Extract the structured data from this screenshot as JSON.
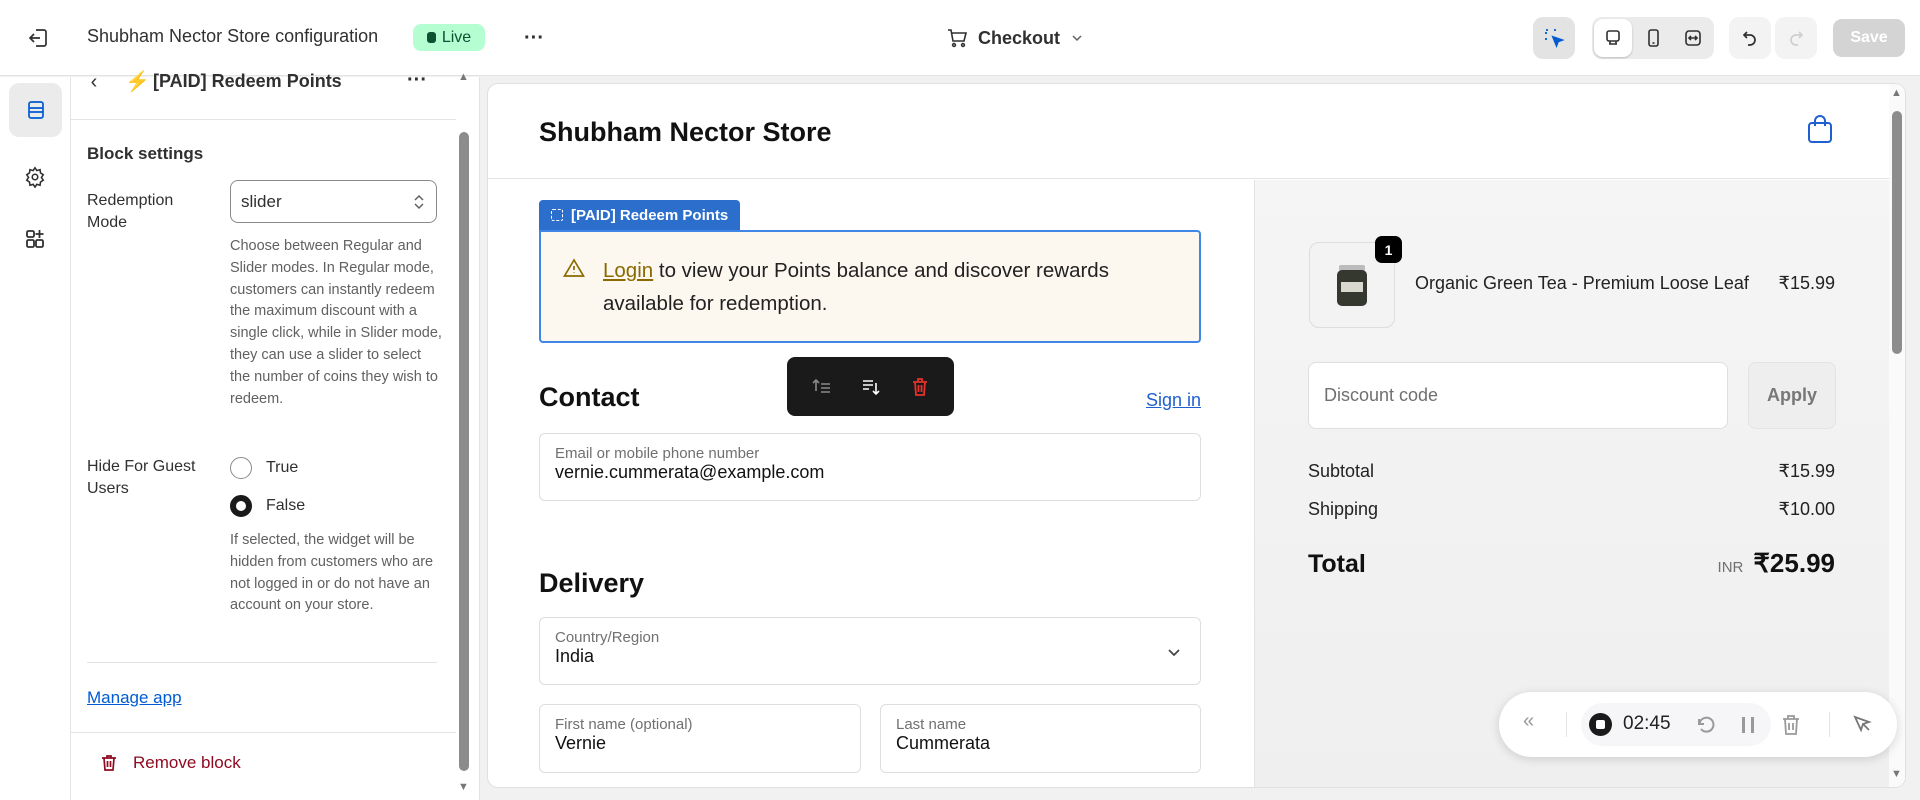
{
  "topbar": {
    "title": "Shubham Nector Store configuration",
    "status": "Live",
    "page_selector": "Checkout",
    "save_label": "Save",
    "accent": "#005bd3"
  },
  "panel": {
    "block_title": "[PAID] Redeem Points",
    "section_title": "Block settings",
    "redemption_label": "Redemption Mode",
    "redemption_value": "slider",
    "redemption_help": "Choose between Regular and Slider modes. In Regular mode, customers can instantly redeem the maximum discount with a single click, while in Slider mode, they can use a slider to select the number of coins they wish to redeem.",
    "guest_label": "Hide For Guest Users",
    "guest_options": [
      "True",
      "False"
    ],
    "guest_selected": "False",
    "guest_help": "If selected, the widget will be hidden from customers who are not logged in or do not have an account on your store.",
    "manage_app": "Manage app",
    "remove_block": "Remove block"
  },
  "preview": {
    "store_name": "Shubham Nector Store",
    "block_tab": "[PAID] Redeem Points",
    "banner_link": "Login",
    "banner_text": " to view your Points balance and discover rewards available for redemption.",
    "contact_title": "Contact",
    "sign_in": "Sign in",
    "email_label": "Email or mobile phone number",
    "email_value": "vernie.cummerata@example.com",
    "delivery_title": "Delivery",
    "country_label": "Country/Region",
    "country_value": "India",
    "first_label": "First name (optional)",
    "first_value": "Vernie",
    "last_label": "Last name",
    "last_value": "Cummerata"
  },
  "summary": {
    "item_qty": "1",
    "item_name": "Organic Green Tea - Premium Loose Leaf",
    "item_price": "₹15.99",
    "discount_placeholder": "Discount code",
    "apply": "Apply",
    "subtotal_label": "Subtotal",
    "subtotal": "₹15.99",
    "shipping_label": "Shipping",
    "shipping": "₹10.00",
    "total_label": "Total",
    "currency": "INR",
    "total": "₹25.99"
  },
  "recorder": {
    "time": "02:45"
  }
}
